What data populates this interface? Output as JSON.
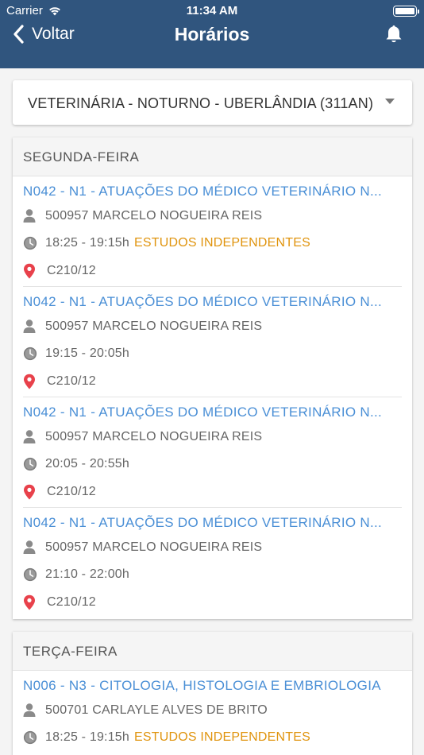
{
  "status_bar": {
    "carrier": "Carrier",
    "time": "11:34 AM"
  },
  "nav": {
    "back_label": "Voltar",
    "title": "Horários"
  },
  "course_select": {
    "value": "VETERINÁRIA - NOTURNO - UBERLÂNDIA (311AN)"
  },
  "days": [
    {
      "name": "SEGUNDA-FEIRA",
      "entries": [
        {
          "course": "N042 - N1 - ATUAÇÕES DO MÉDICO VETERINÁRIO N...",
          "teacher": "500957 MARCELO NOGUEIRA REIS",
          "time": "18:25 - 19:15h",
          "tag": "ESTUDOS INDEPENDENTES",
          "room": "C210/12"
        },
        {
          "course": "N042 - N1 - ATUAÇÕES DO MÉDICO VETERINÁRIO N...",
          "teacher": "500957 MARCELO NOGUEIRA REIS",
          "time": "19:15 - 20:05h",
          "tag": "",
          "room": "C210/12"
        },
        {
          "course": "N042 - N1 - ATUAÇÕES DO MÉDICO VETERINÁRIO N...",
          "teacher": "500957 MARCELO NOGUEIRA REIS",
          "time": "20:05 - 20:55h",
          "tag": "",
          "room": "C210/12"
        },
        {
          "course": "N042 - N1 - ATUAÇÕES DO MÉDICO VETERINÁRIO N...",
          "teacher": "500957 MARCELO NOGUEIRA REIS",
          "time": "21:10 - 22:00h",
          "tag": "",
          "room": "C210/12"
        }
      ]
    },
    {
      "name": "TERÇA-FEIRA",
      "entries": [
        {
          "course": "N006 - N3 - CITOLOGIA, HISTOLOGIA E EMBRIOLOGIA",
          "teacher": "500701 CARLAYLE ALVES DE BRITO",
          "time": "18:25 - 19:15h",
          "tag": "ESTUDOS INDEPENDENTES",
          "room": ""
        }
      ]
    }
  ],
  "colors": {
    "header": "#30557e",
    "link": "#4a8fd6",
    "tag": "#e0940e",
    "pin": "#e8414b"
  }
}
